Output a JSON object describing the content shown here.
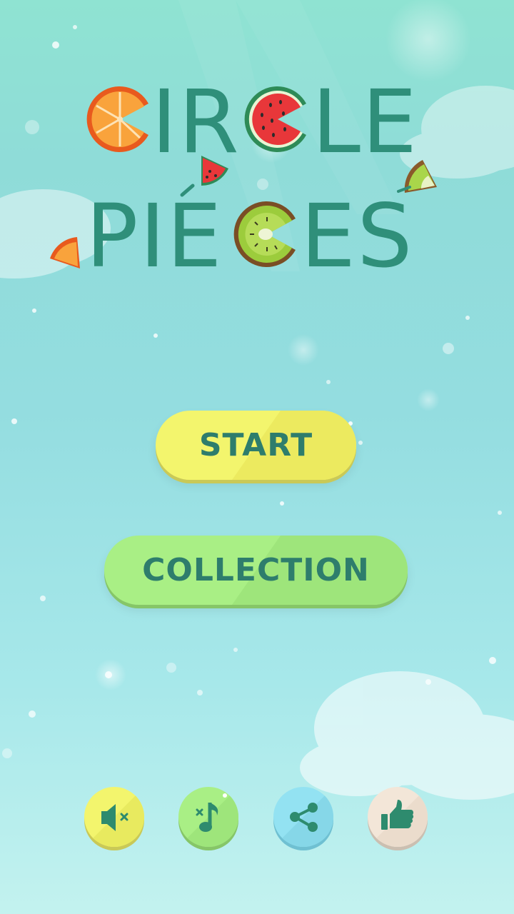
{
  "title": {
    "line1": "CIRCLE",
    "line2": "PIECES"
  },
  "menu": {
    "start_label": "START",
    "collection_label": "COLLECTION"
  },
  "bottom_bar": {
    "sound": {
      "icon": "speaker-mute-icon"
    },
    "music": {
      "icon": "music-note-mute-icon"
    },
    "share": {
      "icon": "share-icon"
    },
    "like": {
      "icon": "thumbs-up-icon"
    }
  },
  "colors": {
    "title": "#2f8f7a",
    "start_button": "#f3f56d",
    "collection_button": "#a9ef85",
    "share_button": "#93e2f2",
    "like_button": "#f3e6d8",
    "button_text": "#2e7d6c"
  }
}
